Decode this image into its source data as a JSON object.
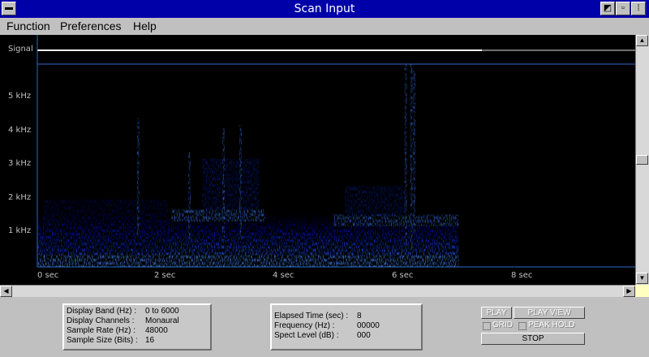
{
  "window": {
    "title": "Scan Input",
    "restore_glyph": "◩",
    "close_glyph": "▫",
    "menu_glyph": "⁞"
  },
  "menu": {
    "items": [
      "Function",
      "Preferences",
      "Help"
    ]
  },
  "plot": {
    "signal_label": "Signal",
    "y_labels": [
      "5 kHz",
      "4 kHz",
      "3 kHz",
      "2 kHz",
      "1 kHz"
    ],
    "x_labels": [
      "0  sec",
      "2  sec",
      "4  sec",
      "6  sec",
      "8  sec"
    ]
  },
  "chart_data": {
    "type": "heatmap",
    "title": "",
    "xlabel": "sec",
    "ylabel": "kHz",
    "xlim": [
      0,
      10.5
    ],
    "ylim": [
      0,
      6
    ],
    "x_ticks": [
      0,
      2,
      4,
      6,
      8
    ],
    "y_ticks": [
      1,
      2,
      3,
      4,
      5
    ],
    "data_end_sec": 7.4,
    "colormap": [
      "#000000",
      "#0000c0",
      "#2266ff",
      "#66aaff",
      "#ffffff"
    ]
  },
  "info_left": {
    "rows": [
      {
        "label": "Display Band (Hz) :",
        "value": "0 to 6000"
      },
      {
        "label": "Display Channels :",
        "value": "Monaural"
      },
      {
        "label": "Sample Rate (Hz) :",
        "value": "48000"
      },
      {
        "label": "Sample Size (Bits) :",
        "value": "16"
      }
    ]
  },
  "info_mid": {
    "rows": [
      {
        "label": "Elapsed Time (sec) :",
        "value": "8"
      },
      {
        "label": "Frequency (Hz) :",
        "value": "00000"
      },
      {
        "label": "Spect Level (dB) :",
        "value": "000"
      }
    ]
  },
  "controls": {
    "play": "PLAY",
    "play_view": "PLAY VIEW",
    "grid": "GRID",
    "peak_hold": "PEAK HOLD",
    "stop": "STOP"
  },
  "colors": {
    "title_bar": "#0000a8",
    "plot_bg": "#000000",
    "signal_line": "#ffffff",
    "window_bg": "#c0c0c0"
  }
}
